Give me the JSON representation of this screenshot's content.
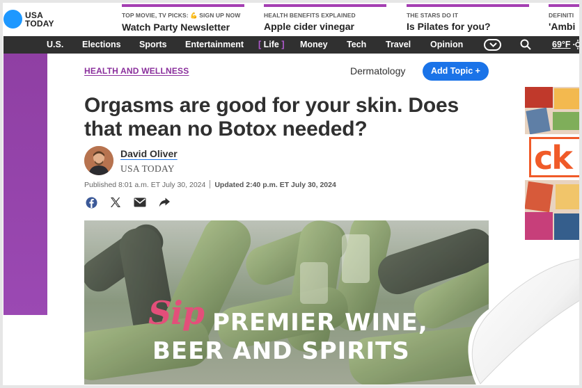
{
  "logo": {
    "line1": "USA",
    "line2": "TODAY"
  },
  "promos": [
    {
      "kicker": "TOP MOVIE, TV PICKS: 💪 SIGN UP NOW",
      "title": "Watch Party Newsletter"
    },
    {
      "kicker": "HEALTH BENEFITS EXPLAINED",
      "title": "Apple cider vinegar"
    },
    {
      "kicker": "THE STARS DO IT",
      "title": "Is Pilates for you?"
    },
    {
      "kicker": "DEFINITI",
      "title": "'Ambi"
    }
  ],
  "nav": {
    "items": [
      "U.S.",
      "Elections",
      "Sports",
      "Entertainment",
      "Life",
      "Money",
      "Tech",
      "Travel",
      "Opinion"
    ],
    "active": "Life",
    "temperature": "69°F"
  },
  "article": {
    "topic": "HEALTH AND WELLNESS",
    "secondary_topic": "Dermatology",
    "add_topic_label": "Add Topic +",
    "headline": "Orgasms are good for your skin. Does that mean no Botox needed?",
    "author": "David Oliver",
    "organization": "USA TODAY",
    "published": "Published 8:01 a.m. ET July 30, 2024",
    "updated": "Updated 2:40 p.m. ET July 30, 2024"
  },
  "share_icons": [
    "facebook-icon",
    "x-icon",
    "email-icon",
    "share-arrow-icon"
  ],
  "hero": {
    "script_word": "Sip",
    "line1": "PREMIER WINE,",
    "line2": "BEER AND SPIRITS"
  },
  "ad": {
    "logo_text": "ck"
  },
  "colors": {
    "brand_blue": "#1e98ff",
    "life_purple": "#a43fb2",
    "nav_dark": "#303030",
    "button_blue": "#1a73e8"
  }
}
